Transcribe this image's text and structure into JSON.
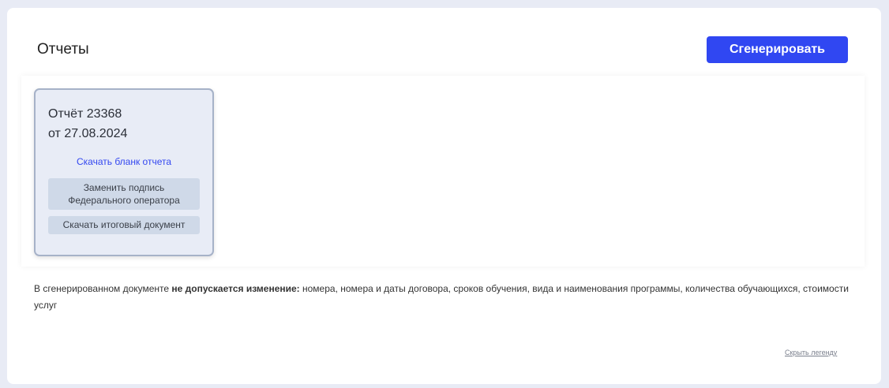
{
  "header": {
    "title": "Отчеты",
    "generate_label": "Сгенерировать"
  },
  "report": {
    "number": "Отчёт 23368",
    "date": "от 27.08.2024",
    "download_blank": "Скачать бланк отчета",
    "replace_signature_line1": "Заменить подпись",
    "replace_signature_line2": "Федерального оператора",
    "download_final": "Скачать итоговый документ"
  },
  "legend": {
    "prefix": "В сгенерированном документе ",
    "bold": "не допускается изменение:",
    "suffix": " номера, номера и даты договора, сроков обучения, вида и наименования программы, количества обучающихся, стоимости услуг",
    "hide_label": "Скрыть легенду"
  },
  "colors": {
    "accent": "#3047f2"
  }
}
